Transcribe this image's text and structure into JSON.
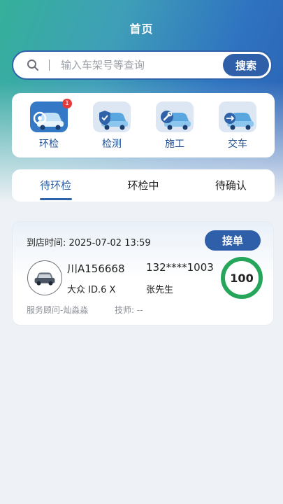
{
  "header": {
    "title": "首页"
  },
  "search": {
    "placeholder": "输入车架号等查询",
    "button_label": "搜索"
  },
  "shortcuts": [
    {
      "label": "环检",
      "icon": "car-inspection-icon",
      "badge": "1",
      "active": true
    },
    {
      "label": "检测",
      "icon": "car-shield-icon",
      "badge": "",
      "active": false
    },
    {
      "label": "施工",
      "icon": "car-wrench-icon",
      "badge": "",
      "active": false
    },
    {
      "label": "交车",
      "icon": "car-handover-icon",
      "badge": "",
      "active": false
    }
  ],
  "tabs": [
    {
      "label": "待环检",
      "active": true
    },
    {
      "label": "环检中",
      "active": false
    },
    {
      "label": "待确认",
      "active": false
    }
  ],
  "order": {
    "arrival": "到店时间: 2025-07-02 13:59",
    "accept_label": "接单",
    "plate": "川A156668",
    "phone": "132****1003",
    "model": "大众 ID.6 X",
    "owner": "张先生",
    "score": "100",
    "advisor": "服务顾问-灿淼淼",
    "technician": "技师: --"
  },
  "colors": {
    "primary": "#2f5fa8",
    "score_ring": "#26a65b",
    "badge": "#e53b3b"
  }
}
